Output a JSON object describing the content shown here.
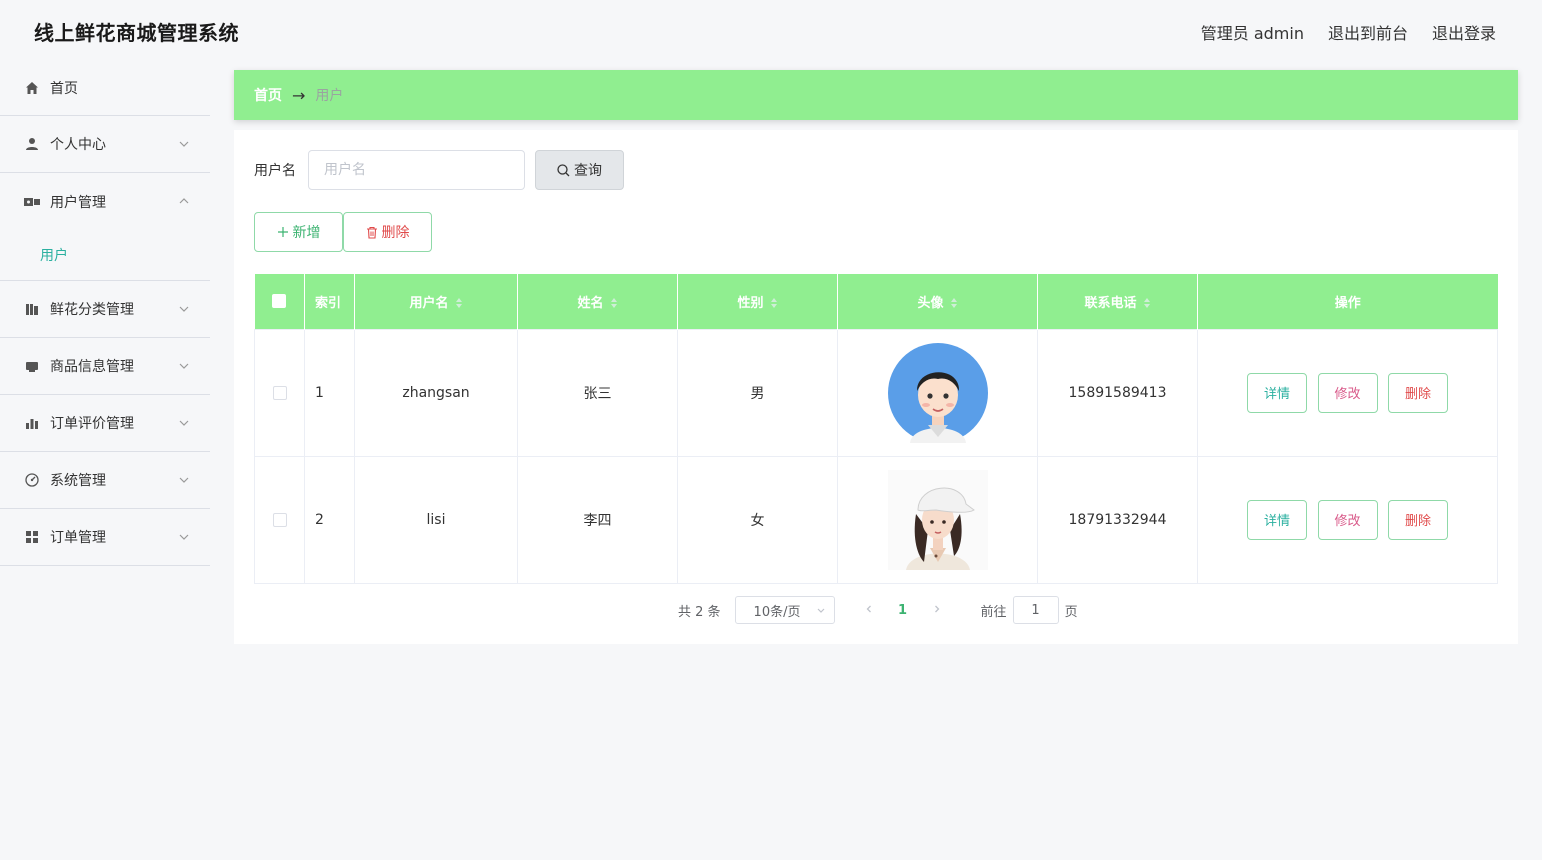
{
  "header": {
    "title": "线上鲜花商城管理系统",
    "admin_label": "管理员 admin",
    "to_front_label": "退出到前台",
    "logout_label": "退出登录"
  },
  "sidebar": {
    "items": [
      {
        "label": "首页",
        "icon": "home-icon"
      },
      {
        "label": "个人中心",
        "icon": "user-icon"
      },
      {
        "label": "用户管理",
        "icon": "users-icon",
        "expanded": true,
        "children": [
          {
            "label": "用户"
          }
        ]
      },
      {
        "label": "鲜花分类管理",
        "icon": "category-icon"
      },
      {
        "label": "商品信息管理",
        "icon": "goods-icon"
      },
      {
        "label": "订单评价管理",
        "icon": "chart-icon"
      },
      {
        "label": "系统管理",
        "icon": "system-icon"
      },
      {
        "label": "订单管理",
        "icon": "grid-icon"
      }
    ]
  },
  "breadcrumb": {
    "home": "首页",
    "arrow": "→",
    "current": "用户"
  },
  "search": {
    "label": "用户名",
    "placeholder": "用户名",
    "value": "",
    "button": "查询"
  },
  "actions": {
    "add": "新增",
    "delete": "删除"
  },
  "table": {
    "headers": [
      "索引",
      "用户名",
      "姓名",
      "性别",
      "头像",
      "联系电话",
      "操作"
    ],
    "rows": [
      {
        "index": "1",
        "username": "zhangsan",
        "name": "张三",
        "gender": "男",
        "avatar": "male-avatar",
        "phone": "15891589413"
      },
      {
        "index": "2",
        "username": "lisi",
        "name": "李四",
        "gender": "女",
        "avatar": "female-avatar",
        "phone": "18791332944"
      }
    ],
    "row_actions": {
      "detail": "详情",
      "edit": "修改",
      "delete": "删除"
    }
  },
  "pagination": {
    "total": "共 2 条",
    "page_size": "10条/页",
    "current": "1",
    "goto_label": "前往",
    "goto_value": "1",
    "page_suffix": "页"
  },
  "colors": {
    "accent": "#90ee90",
    "link": "#2bb0a0",
    "danger": "#e04a4a",
    "edit": "#d95a8a"
  }
}
